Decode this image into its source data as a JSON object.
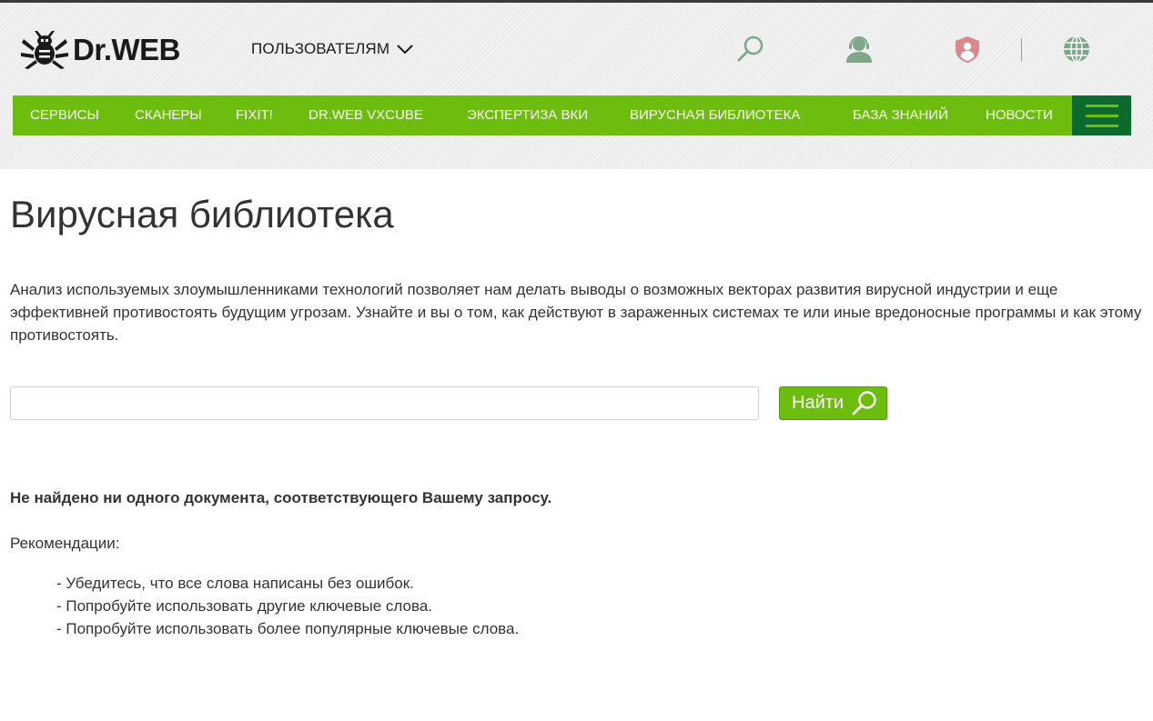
{
  "header": {
    "logo_text": "Dr.WEB",
    "users_menu_label": "ПОЛЬЗОВАТЕЛЯМ",
    "icons": [
      "search-icon",
      "support-icon",
      "profile-shield-icon",
      "globe-icon"
    ]
  },
  "nav": {
    "items": [
      {
        "label": "СЕРВИСЫ"
      },
      {
        "label": "СКАНЕРЫ"
      },
      {
        "label": "FIXIT!"
      },
      {
        "label": "DR.WEB VXCUBE"
      },
      {
        "label": "ЭКСПЕРТИЗА ВКИ"
      },
      {
        "label": "ВИРУСНАЯ БИБЛИОТЕКА"
      },
      {
        "label": "БАЗА ЗНАНИЙ"
      },
      {
        "label": "НОВОСТИ"
      }
    ]
  },
  "main": {
    "title": "Вирусная библиотека",
    "intro": "Анализ используемых злоумышленниками технологий позволяет нам делать выводы о возможных векторах развития вирусной индустрии и еще эффективней противостоять будущим угрозам. Узнайте и вы о том, как действуют в зараженных системах те или иные вредоносные программы и как этому противостоять.",
    "search": {
      "value": "",
      "button_label": "Найти"
    },
    "not_found": "Не найдено ни одного документа, соответствующего Вашему запросу.",
    "recommendations_title": "Рекомендации:",
    "recommendations": [
      "- Убедитесь, что все слова написаны без ошибок.",
      "- Попробуйте использовать другие ключевые слова.",
      "- Попробуйте использовать более популярные ключевые слова."
    ]
  },
  "colors": {
    "brand_green": "#6cbd0d",
    "dark_green": "#0c6a2e",
    "icon_green": "#7fa58a",
    "icon_red": "#d9898b",
    "text": "#333333"
  }
}
